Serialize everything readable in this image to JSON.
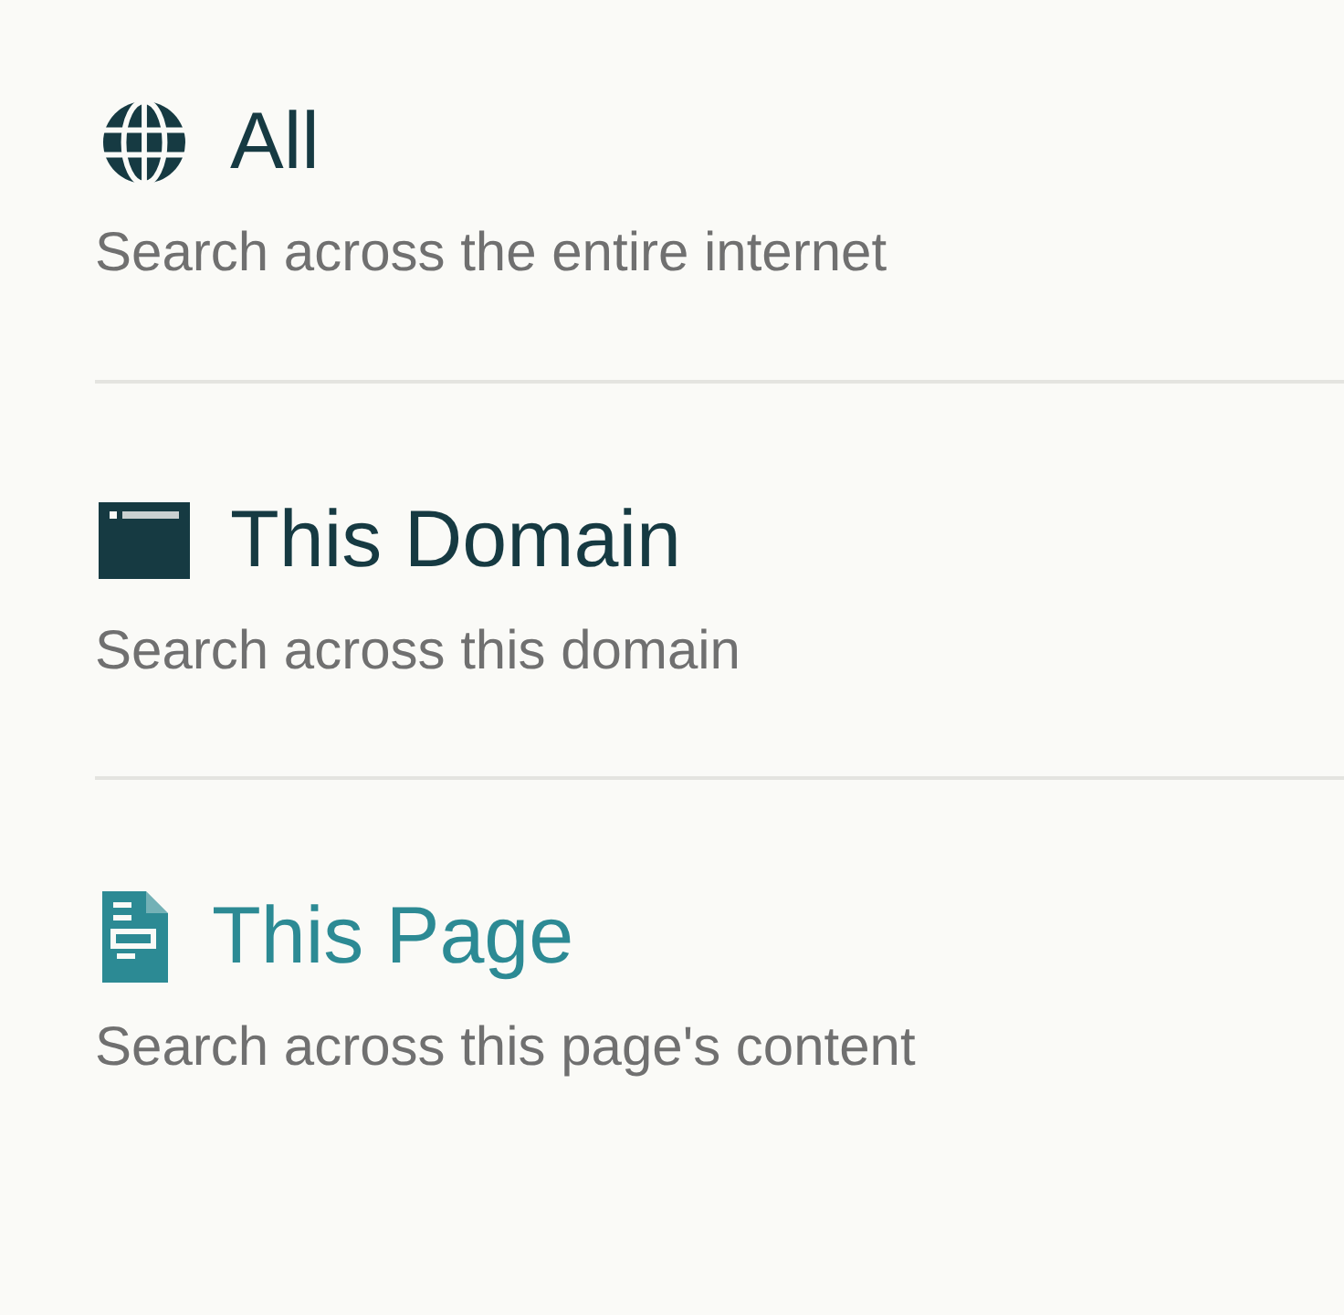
{
  "scopes": [
    {
      "kind": "globe",
      "title": "All",
      "description": "Search across the entire internet",
      "selected": false
    },
    {
      "kind": "window",
      "title": "This Domain",
      "description": "Search across this domain",
      "selected": false
    },
    {
      "kind": "document",
      "title": "This Page",
      "description": "Search across this page's content",
      "selected": true
    }
  ]
}
